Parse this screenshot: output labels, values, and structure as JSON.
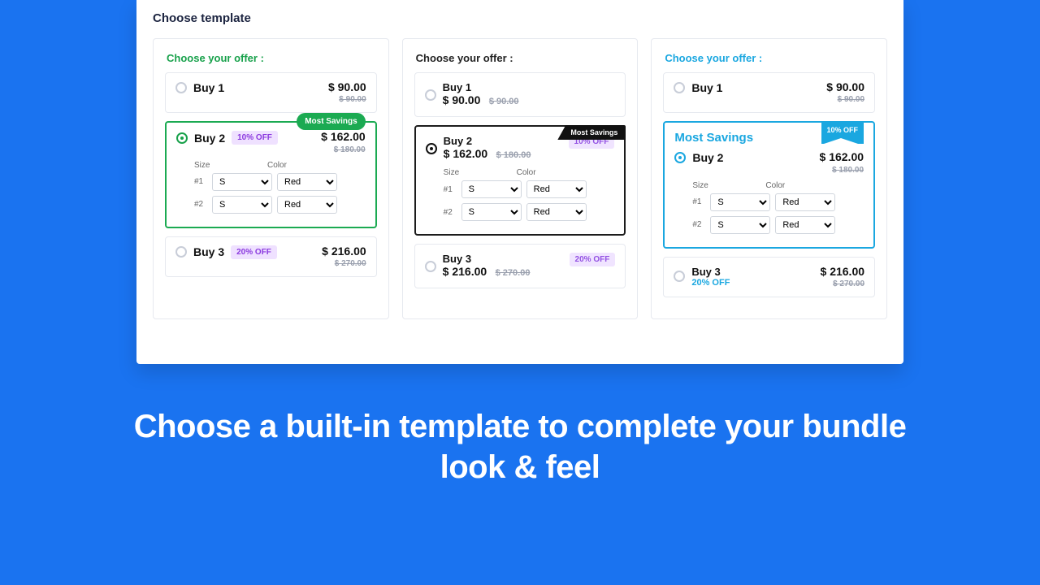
{
  "panel_title": "Choose template",
  "choose_label": "Choose your offer :",
  "badge_most": "Most Savings",
  "badge_10": "10% OFF",
  "badge_20": "20% OFF",
  "size_label": "Size",
  "color_label": "Color",
  "row1": "#1",
  "row2": "#2",
  "opt_size": "S",
  "opt_color": "Red",
  "buy1": {
    "title": "Buy 1",
    "price": "$ 90.00",
    "old": "$ 90.00"
  },
  "buy2": {
    "title": "Buy 2",
    "price": "$ 162.00",
    "old": "$ 180.00"
  },
  "buy3": {
    "title": "Buy 3",
    "price": "$ 216.00",
    "old": "$ 270.00"
  },
  "headline": "Choose a built-in template to complete your bundle look & feel"
}
